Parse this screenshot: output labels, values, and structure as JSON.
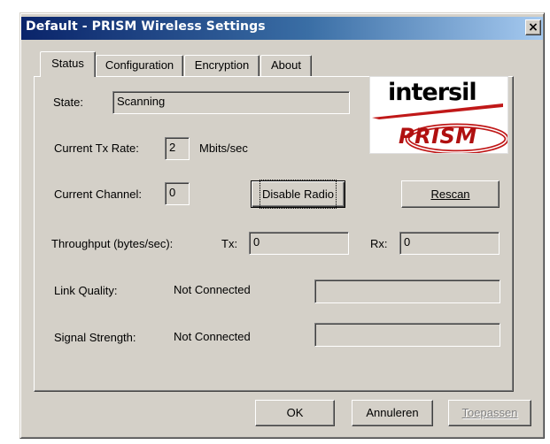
{
  "window": {
    "title": "Default - PRISM Wireless Settings",
    "close_symbol": "×",
    "colors": {
      "title_bar": "#0a246a",
      "face": "#d4d0c8",
      "logo_red": "#b01010"
    }
  },
  "tabs": [
    {
      "label": "Status",
      "active": true
    },
    {
      "label": "Configuration",
      "active": false
    },
    {
      "label": "Encryption",
      "active": false
    },
    {
      "label": "About",
      "active": false
    }
  ],
  "status": {
    "state_label": "State:",
    "state_value": "Scanning",
    "tx_rate_label": "Current Tx Rate:",
    "tx_rate_value": "2",
    "tx_rate_unit": "Mbits/sec",
    "channel_label": "Current Channel:",
    "channel_value": "0",
    "disable_radio_label": "Disable Radio",
    "rescan_label": "Rescan",
    "throughput_label": "Throughput (bytes/sec):",
    "tx_label": "Tx:",
    "tx_value": "0",
    "rx_label": "Rx:",
    "rx_value": "0",
    "link_quality_label": "Link Quality:",
    "link_quality_value": "Not Connected",
    "signal_strength_label": "Signal Strength:",
    "signal_strength_value": "Not Connected"
  },
  "logo": {
    "brand_top": "intersil",
    "brand_bottom": "PRISM"
  },
  "footer": {
    "ok_label": "OK",
    "cancel_label": "Annuleren",
    "apply_label": "Toepassen"
  }
}
